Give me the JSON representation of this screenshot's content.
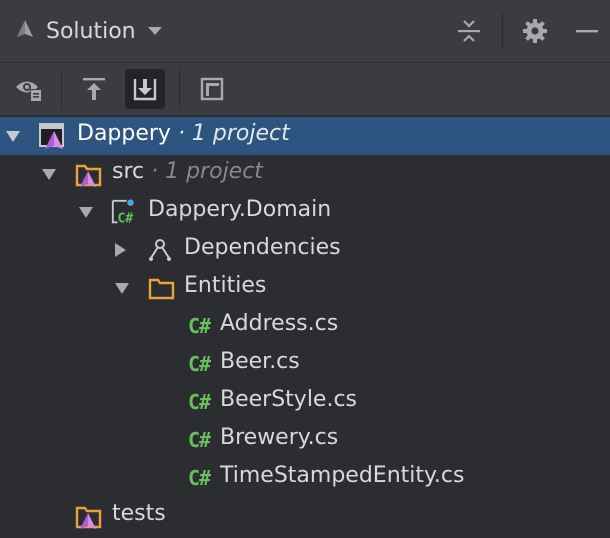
{
  "header": {
    "title": "Solution"
  },
  "toolbar": {
    "buttons": [
      "show-options",
      "collapse-all",
      "expand-all",
      "preview"
    ]
  },
  "tree": [
    {
      "label": "Dappery",
      "sub": " · 1 project",
      "icon": "solution-icon",
      "expanded": true,
      "selected": true
    },
    {
      "label": "src",
      "sub": " · 1 project",
      "icon": "solution-folder-icon",
      "expanded": true
    },
    {
      "label": "Dappery.Domain",
      "sub": "",
      "icon": "csharp-project-icon",
      "expanded": true
    },
    {
      "label": "Dependencies",
      "sub": "",
      "icon": "dependencies-icon",
      "expanded": false
    },
    {
      "label": "Entities",
      "sub": "",
      "icon": "folder-icon",
      "expanded": true
    },
    {
      "label": "Address.cs",
      "sub": "",
      "icon": "csharp-file-icon"
    },
    {
      "label": "Beer.cs",
      "sub": "",
      "icon": "csharp-file-icon"
    },
    {
      "label": "BeerStyle.cs",
      "sub": "",
      "icon": "csharp-file-icon"
    },
    {
      "label": "Brewery.cs",
      "sub": "",
      "icon": "csharp-file-icon"
    },
    {
      "label": "TimeStampedEntity.cs",
      "sub": "",
      "icon": "csharp-file-icon"
    },
    {
      "label": "tests",
      "sub": "",
      "icon": "solution-folder-icon"
    }
  ],
  "icons": {
    "csharp_glyph": "C#"
  },
  "colors": {
    "background": "#2b2d30",
    "panel": "#3a3c3f",
    "selection": "#2e5480",
    "folder": "#e8a33d",
    "csharp": "#67c05d",
    "solution_accent": "#b55ad6"
  }
}
